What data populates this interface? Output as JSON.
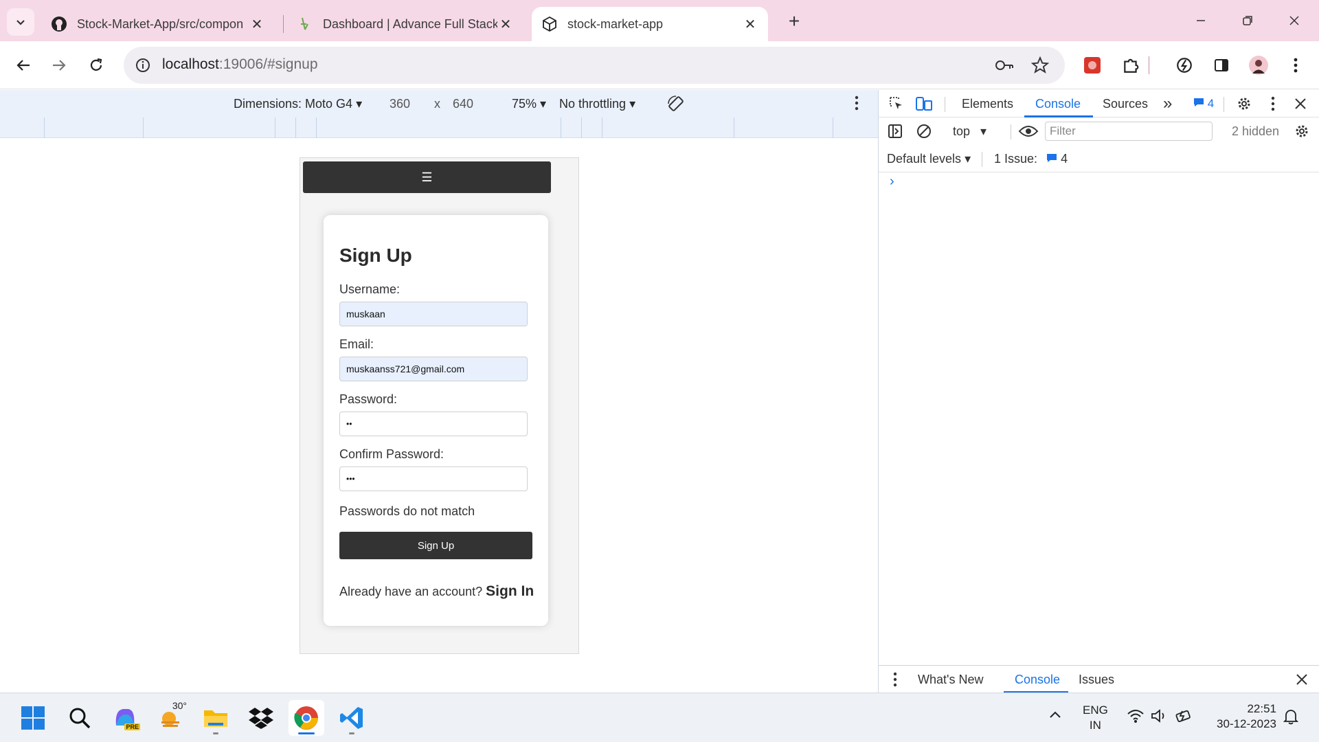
{
  "browser": {
    "tabs": [
      {
        "title": "Stock-Market-App/src/compon",
        "icon": "github-icon"
      },
      {
        "title": "Dashboard | Advance Full Stack",
        "icon": "mentor-icon"
      },
      {
        "title": "stock-market-app",
        "icon": "cube-icon",
        "active": true
      }
    ],
    "url_host": "localhost",
    "url_path": ":19006/#signup"
  },
  "device_toolbar": {
    "dimensions_label": "Dimensions: Moto G4",
    "width": "360",
    "times": "x",
    "height": "640",
    "zoom": "75%",
    "throttling": "No throttling"
  },
  "app": {
    "menu_glyph": "☰",
    "title": "Sign Up",
    "username_label": "Username:",
    "username_value": "muskaan",
    "email_label": "Email:",
    "email_value": "muskaanss721@gmail.com",
    "password_label": "Password:",
    "password_value": "••",
    "confirm_label": "Confirm Password:",
    "confirm_value": "•••",
    "error_message": "Passwords do not match",
    "signup_button": "Sign Up",
    "have_account": "Already have an account?",
    "signin_link": "Sign In"
  },
  "devtools": {
    "tabs": [
      "Elements",
      "Console",
      "Sources"
    ],
    "active_tab": "Console",
    "message_count": "4",
    "context": "top",
    "filter_placeholder": "Filter",
    "hidden_count": "2 hidden",
    "levels": "Default levels",
    "issues_label": "1 Issue:",
    "issues_count": "4",
    "drawer_tabs": [
      "What's New",
      "Console",
      "Issues"
    ]
  },
  "taskbar": {
    "weather_temp": "30°",
    "copilot_badge": "PRE",
    "language": "ENG",
    "region": "IN",
    "time": "22:51",
    "date": "30-12-2023"
  },
  "colors": {
    "tab_strip": "#f6d9e6",
    "app_dark": "#333333",
    "autofill": "#e8f0fe",
    "devtools_accent": "#1a73e8"
  }
}
